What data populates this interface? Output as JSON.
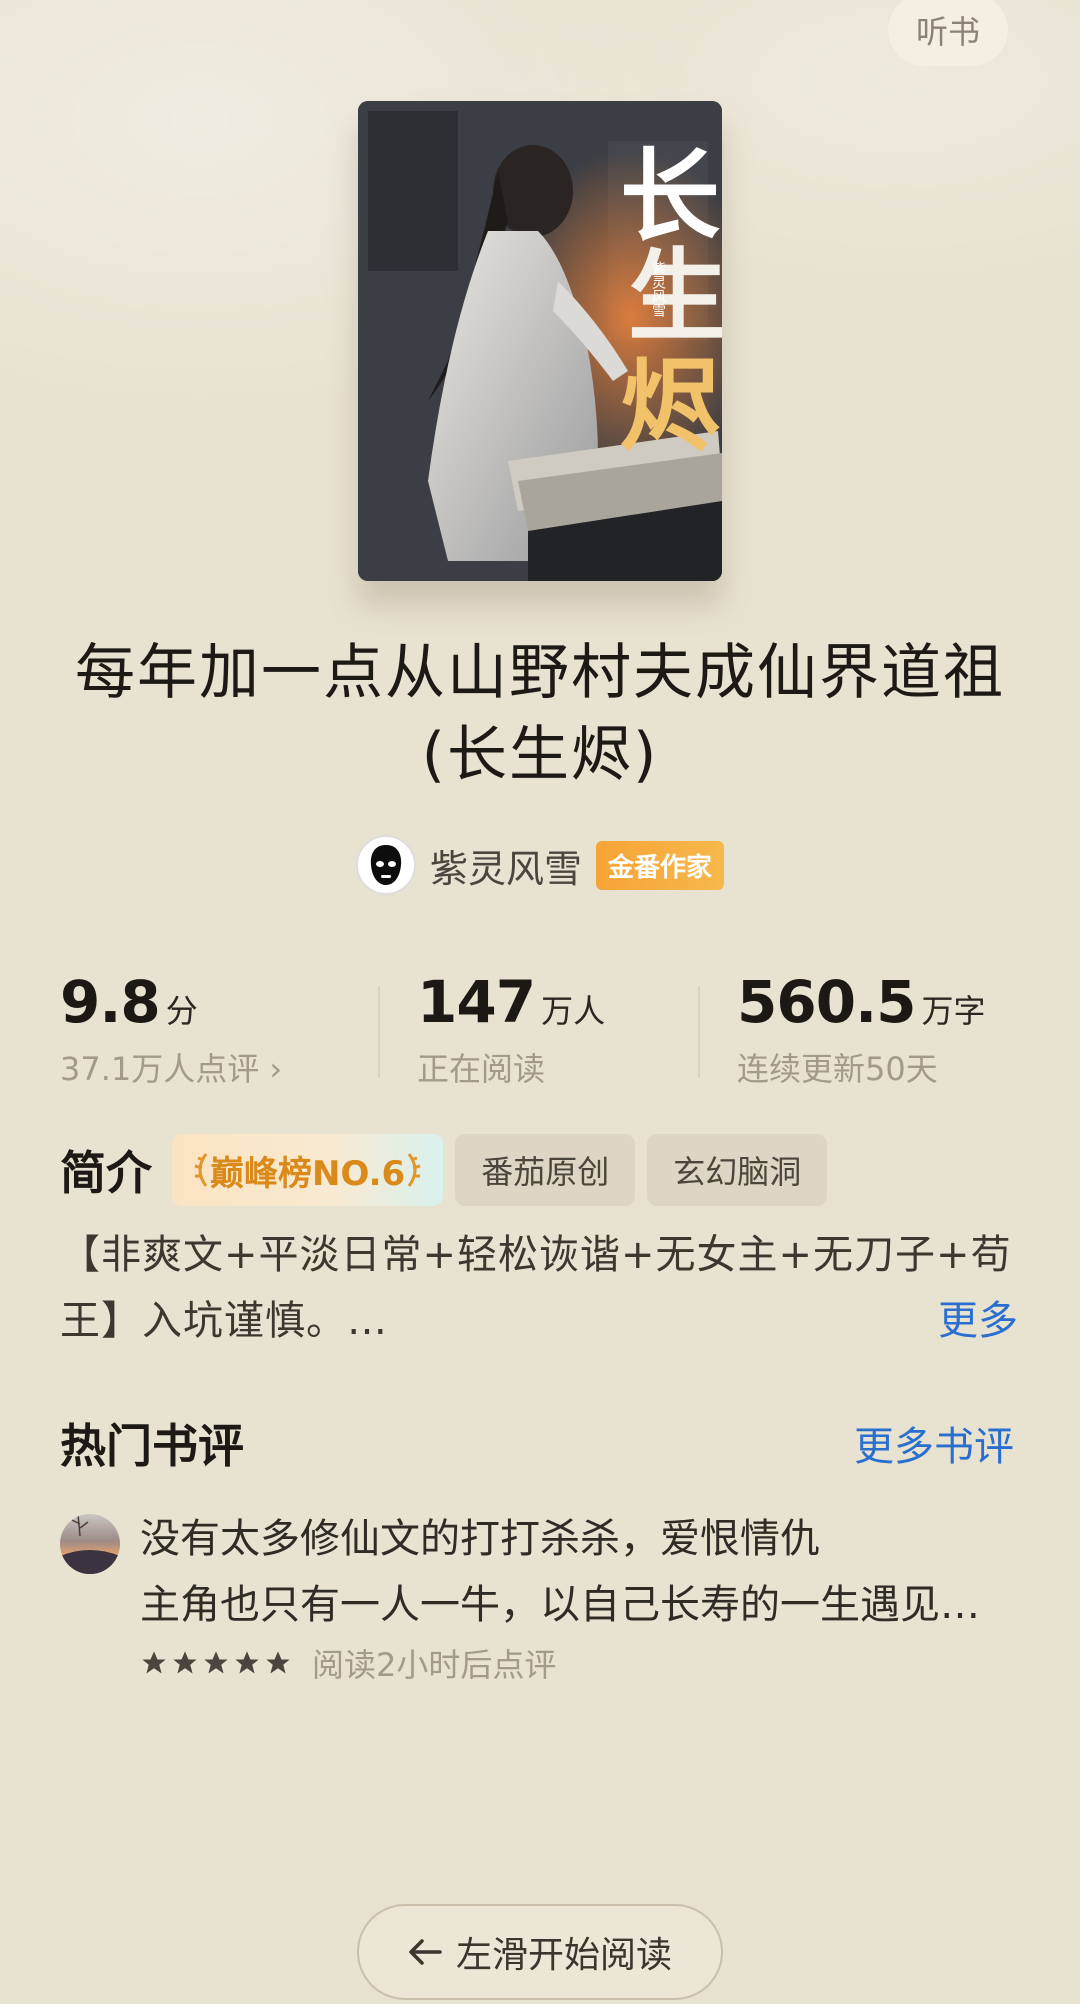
{
  "header": {
    "listen_label": "听书"
  },
  "book": {
    "cover_title": "长生烬",
    "cover_author": "紫灵风雪",
    "cover_mark": "著",
    "title": "每年加一点从山野村夫成仙界道祖(长生烬)",
    "author": "紫灵风雪",
    "author_badge": "金番作家"
  },
  "stats": {
    "rating": {
      "value": "9.8",
      "unit": "分",
      "sub": "37.1万人点评 ›"
    },
    "readers": {
      "value": "147",
      "unit": "万人",
      "sub": "正在阅读"
    },
    "words": {
      "value": "560.5",
      "unit": "万字",
      "sub": "连续更新50天"
    }
  },
  "intro": {
    "label": "简介",
    "rank_tag": "巅峰榜NO.6",
    "tags": [
      "番茄原创",
      "玄幻脑洞"
    ],
    "text": "【非爽文+平淡日常+轻松诙谐+无女主+无刀子+苟王】入坑谨慎。…",
    "more": "更多"
  },
  "reviews": {
    "title": "热门书评",
    "more": "更多书评",
    "items": [
      {
        "line1": "没有太多修仙文的打打杀杀，爱恨情仇",
        "line2": "主角也只有一人一牛，以自己长寿的一生遇见…",
        "stars": 5,
        "meta": "阅读2小时后点评"
      }
    ]
  },
  "footer": {
    "start_label": "左滑开始阅读"
  },
  "colors": {
    "background": "#e8e2d1",
    "link": "#2a6fd0",
    "badge": "#f7a437",
    "rank": "#d98a1a"
  }
}
